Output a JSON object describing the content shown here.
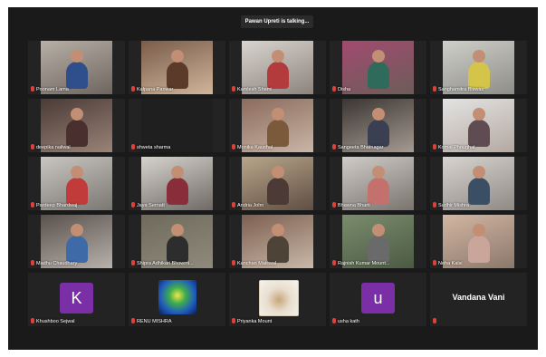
{
  "talking_banner": "Pawan Upreti is talking...",
  "colors": {
    "avatar_purple": "#7b2fa7",
    "frame_background": "#1a1a1a",
    "mic_muted": "#e0403a"
  },
  "participants": [
    {
      "name": "Poonam Lama",
      "kind": "video"
    },
    {
      "name": "Kalpana Panwar",
      "kind": "video"
    },
    {
      "name": "Kamlesh Shami",
      "kind": "video"
    },
    {
      "name": "Disha",
      "kind": "video"
    },
    {
      "name": "Sanghamitra Biswas",
      "kind": "video"
    },
    {
      "name": "deepika nailwal",
      "kind": "video"
    },
    {
      "name": "shweta sharma",
      "kind": "video"
    },
    {
      "name": "Monika Kaushal",
      "kind": "video"
    },
    {
      "name": "Sangeeta Bhatnagar",
      "kind": "video"
    },
    {
      "name": "Komal Phoughat",
      "kind": "video"
    },
    {
      "name": "Pardeep Bhardwaj",
      "kind": "video"
    },
    {
      "name": "Jaya Sernatt",
      "kind": "video"
    },
    {
      "name": "Andria John",
      "kind": "video"
    },
    {
      "name": "Bhawna Bharti",
      "kind": "video"
    },
    {
      "name": "Sudhir Mishra",
      "kind": "video"
    },
    {
      "name": "Madhu Chaudhary",
      "kind": "video"
    },
    {
      "name": "Shipra Adhikari Bhowmi...",
      "kind": "video"
    },
    {
      "name": "Kanchan Maiswal",
      "kind": "video"
    },
    {
      "name": "Rajnish Kumar Mount...",
      "kind": "video"
    },
    {
      "name": "Neha Kalsi",
      "kind": "video"
    },
    {
      "name": "Khushboo Sejwal",
      "kind": "avatar",
      "letter": "K"
    },
    {
      "name": "RENU MISHRA",
      "kind": "picture"
    },
    {
      "name": "Priyanka Mount",
      "kind": "picture"
    },
    {
      "name": "usha kath",
      "kind": "avatar",
      "letter": "u"
    },
    {
      "name": "",
      "kind": "text",
      "display_name": "Vandana Vani"
    }
  ]
}
